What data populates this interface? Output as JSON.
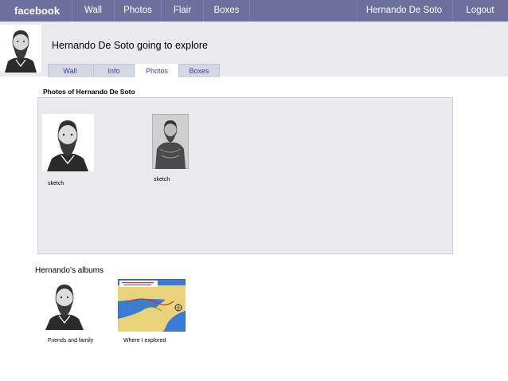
{
  "nav": {
    "brand": "facebook",
    "items": [
      {
        "label": "Wall"
      },
      {
        "label": "Photos"
      },
      {
        "label": "Flair"
      },
      {
        "label": "Boxes"
      }
    ],
    "user_name": "Hernando De Soto",
    "logout": "Logout"
  },
  "profile": {
    "status_title": "Hernando De Soto going to explore",
    "tabs": [
      {
        "label": "Wall"
      },
      {
        "label": "Info"
      },
      {
        "label": "Photos"
      },
      {
        "label": "Boxes"
      }
    ],
    "active_tab": "Photos"
  },
  "photos_section": {
    "heading": "Photos of Hernando De Soto",
    "photos": [
      {
        "caption": "sketch"
      },
      {
        "caption": "sketch"
      }
    ]
  },
  "albums": {
    "heading": "Hernando’s albums",
    "items": [
      {
        "caption": "Friends and family"
      },
      {
        "caption": "Where I explored"
      }
    ]
  },
  "colors": {
    "topbar": "#6d6f9c",
    "band": "#e9e9ee",
    "tab_text": "#3b3fa0"
  }
}
